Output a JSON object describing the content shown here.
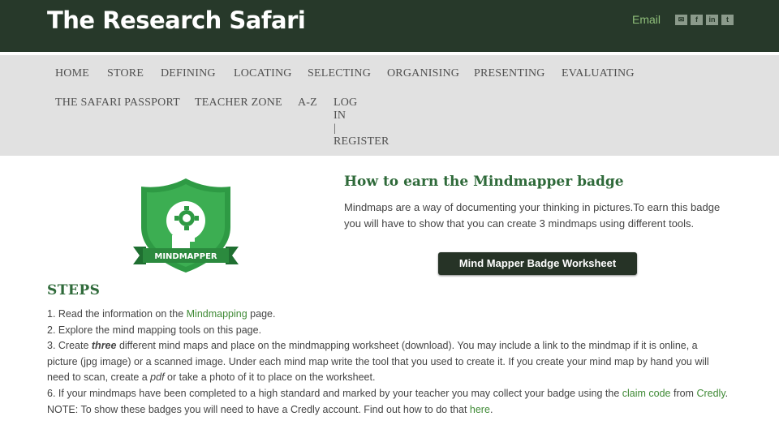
{
  "header": {
    "site_title": "The Research Safari",
    "email_label": "Email",
    "social_icons": [
      {
        "name": "email-icon",
        "glyph": "✉"
      },
      {
        "name": "facebook-icon",
        "glyph": "f"
      },
      {
        "name": "linkedin-icon",
        "glyph": "in"
      },
      {
        "name": "twitter-icon",
        "glyph": "t"
      }
    ]
  },
  "nav": {
    "home": "HOME",
    "store": "STORE",
    "defining": "DEFINING",
    "locating": "LOCATING",
    "selecting": "SELECTING",
    "organising": "ORGANISING",
    "presenting": "PRESENTING",
    "evaluating": "EVALUATING",
    "passport": "THE SAFARI PASSPORT",
    "teacher_zone": "TEACHER ZONE",
    "a_z": "A-Z",
    "log": "LOG",
    "in": "IN",
    "bar": "|",
    "register": "REGISTER"
  },
  "badge": {
    "ribbon_text": "MINDMAPPER",
    "heading_prefix": "How to earn the ",
    "heading_bold": "Mindmapper",
    "heading_suffix": " badge",
    "description": "Mindmaps are a way of documenting your thinking in pictures.To earn this badge you will have to show that you can create 3 mindmaps using different tools.",
    "worksheet_button": "Mind Mapper Badge Worksheet"
  },
  "steps": {
    "title": "STEPS",
    "s1_pre": "1. Read the information on the ",
    "s1_link": "Mindmapping",
    "s1_post": " page.",
    "s2": "2. Explore the mind mapping tools on this page.",
    "s3_pre": "3. Create ",
    "s3_em": "three",
    "s3_mid": " different mind maps and place on the mindmapping worksheet (download). You may include a link to the mindmap if it is online, a picture (jpg image) or a scanned image. Under each mind map write the tool that you used to create it. If you create your mind map by hand you will need to scan, create a ",
    "s3_pdf": "pdf",
    "s3_post": " or take a photo of it to place on the worksheet.",
    "s6_pre": "6. If your mindmaps have been completed to a high standard and marked by your teacher you may collect your badge using the ",
    "s6_link1": "claim code",
    "s6_mid": " from ",
    "s6_link2": "Credly",
    "s6_post": ".",
    "note_pre": "NOTE: To show these badges you will need to have a Credly account. Find out how to do that ",
    "note_link": "here",
    "note_post": "."
  },
  "colors": {
    "header_bg": "#27392a",
    "nav_bg": "#e1e1e1",
    "accent_green": "#2f6a3a",
    "link_green": "#3f8a35",
    "badge_green": "#2e9a44",
    "button_bg": "#263326"
  }
}
